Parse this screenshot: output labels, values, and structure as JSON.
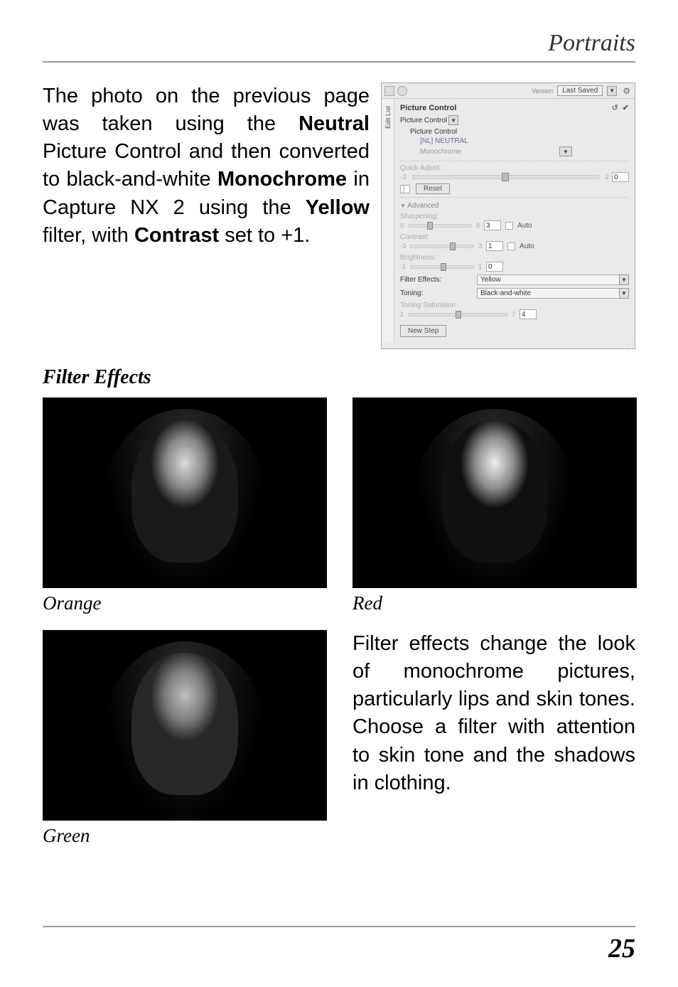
{
  "header": {
    "section_title": "Portraits"
  },
  "intro": {
    "parts": [
      "The photo on the previous page was taken using the ",
      "Neutral",
      " Picture Control and then converted to black-and-white ",
      "Monochrome",
      " in Capture NX 2 using the ",
      "Yellow",
      " filter, with ",
      "Contrast",
      " set to +1."
    ]
  },
  "panel": {
    "version_label": "Version",
    "last_saved": "Last Saved",
    "side_tab": "Edit List",
    "title": "Picture Control",
    "dropdown_label": "Picture Control",
    "subtitle": "Picture Control",
    "preset": "[NL] NEUTRAL",
    "mode": "Monochrome",
    "quick_adjust": {
      "label": "Quick Adjust:",
      "min": "-2",
      "max": "2",
      "value": "0"
    },
    "reset": "Reset",
    "advanced": "Advanced",
    "sharpening": {
      "label": "Sharpening:",
      "min": "0",
      "max": "9",
      "value": "3",
      "auto": "Auto"
    },
    "contrast": {
      "label": "Contrast:",
      "min": "-3",
      "max": "3",
      "value": "1",
      "auto": "Auto"
    },
    "brightness": {
      "label": "Brightness:",
      "min": "-1",
      "max": "1",
      "value": "0"
    },
    "filter_effects": {
      "label": "Filter Effects:",
      "value": "Yellow"
    },
    "toning": {
      "label": "Toning:",
      "value": "Black-and-white"
    },
    "toning_saturation": {
      "label": "Toning Saturation",
      "min": "1",
      "max": "7",
      "value": "4"
    },
    "new_step": "New Step"
  },
  "filter_effects": {
    "heading": "Filter Effects",
    "captions": {
      "orange": "Orange",
      "red": "Red",
      "green": "Green"
    },
    "description": "Filter effects change the look of monochrome pictures, particularly lips and skin tones. Choose a filter with attention to skin tone and the shadows in clothing."
  },
  "footer": {
    "page_number": "25"
  },
  "chart_data": {
    "type": "table",
    "title": "Picture Control panel settings",
    "rows": [
      {
        "parameter": "Quick Adjust",
        "range": "-2 to 2",
        "value": 0
      },
      {
        "parameter": "Sharpening",
        "range": "0 to 9",
        "value": 3,
        "auto": false
      },
      {
        "parameter": "Contrast",
        "range": "-3 to 3",
        "value": 1,
        "auto": false
      },
      {
        "parameter": "Brightness",
        "range": "-1 to 1",
        "value": 0
      },
      {
        "parameter": "Filter Effects",
        "value": "Yellow"
      },
      {
        "parameter": "Toning",
        "value": "Black-and-white"
      },
      {
        "parameter": "Toning Saturation",
        "range": "1 to 7",
        "value": 4
      }
    ]
  }
}
